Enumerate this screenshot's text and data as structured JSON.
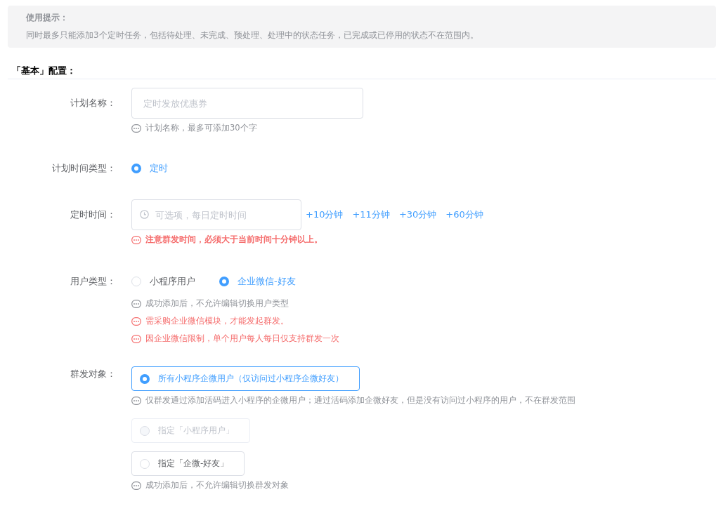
{
  "notice": {
    "title": "使用提示：",
    "text": "同时最多只能添加3个定时任务，包括待处理、未完成、预处理、处理中的状态任务，已完成或已停用的状态不在范围内。"
  },
  "section_title": "「基本」配置：",
  "fields": [
    {
      "kind": "input",
      "label": "计划名称：",
      "placeholder": "定时发放优惠券",
      "hints": [
        {
          "text": "计划名称，最多可添加30个字",
          "error": false,
          "strong": false
        }
      ]
    },
    {
      "kind": "radios",
      "label": "计划时间类型：",
      "options": [
        {
          "label": "定时",
          "selected": true
        }
      ]
    },
    {
      "kind": "time",
      "label": "定时时间：",
      "placeholder": "可选项，每日定时时间",
      "links": [
        "+10分钟",
        "+11分钟",
        "+30分钟",
        "+60分钟"
      ],
      "hints": [
        {
          "text": "注意群发时间，必须大于当前时间十分钟以上。",
          "error": true,
          "strong": true
        }
      ]
    },
    {
      "kind": "radios",
      "label": "用户类型：",
      "options": [
        {
          "label": "小程序用户",
          "selected": false
        },
        {
          "label": "企业微信-好友",
          "selected": true
        }
      ],
      "hints": [
        {
          "text": "成功添加后，不允许编辑切换用户类型",
          "error": false,
          "strong": false
        },
        {
          "text": "需采购企业微信模块，才能发起群发。",
          "error": true,
          "strong": false
        },
        {
          "text": "因企业微信限制，单个用户每人每日仅支持群发一次",
          "error": true,
          "strong": false
        }
      ]
    },
    {
      "kind": "cards",
      "label": "群发对象：",
      "items": [
        {
          "kind": "option",
          "label": "所有小程序企微用户（仅访问过小程序企微好友）",
          "selected": true,
          "disabled": false
        },
        {
          "kind": "hint",
          "text": "仅群发通过添加活码进入小程序的企微用户；通过活码添加企微好友，但是没有访问过小程序的用户，不在群发范围",
          "error": false,
          "strong": false
        },
        {
          "kind": "option",
          "label": "指定「小程序用户」",
          "selected": false,
          "disabled": true
        },
        {
          "kind": "option",
          "label": "指定「企微-好友」",
          "selected": false,
          "disabled": false
        },
        {
          "kind": "hint",
          "text": "成功添加后，不允许编辑切换群发对象",
          "error": false,
          "strong": false
        }
      ]
    }
  ]
}
